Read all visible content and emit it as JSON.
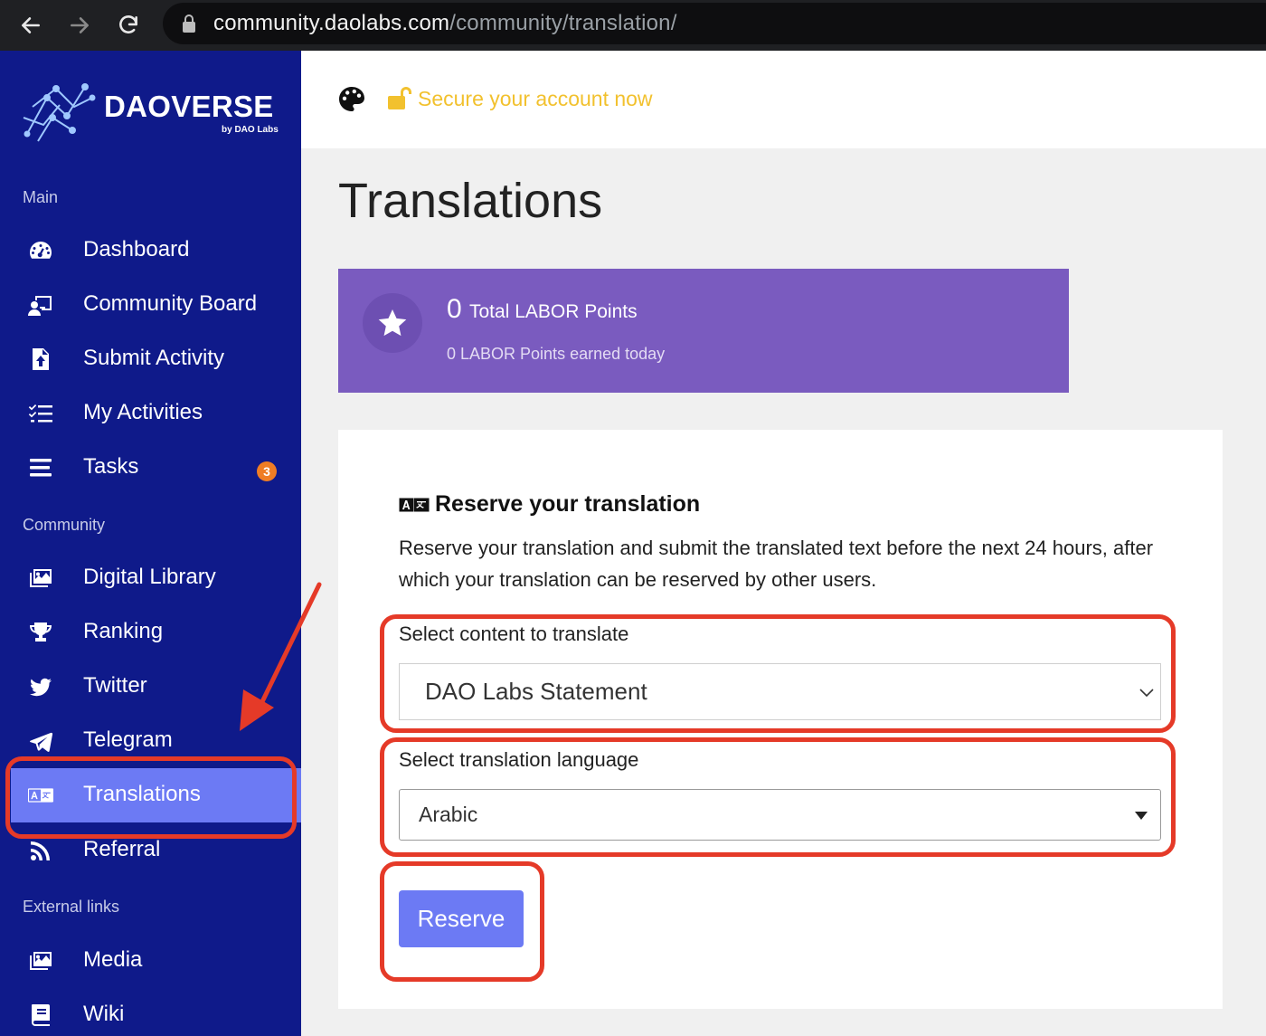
{
  "browser": {
    "url_host": "community.daolabs.com",
    "url_path": "/community/translation/"
  },
  "sidebar": {
    "logo_text": "DAOVERSE",
    "logo_sub": "by DAO Labs",
    "sections": {
      "main": "Main",
      "community": "Community",
      "external": "External links"
    },
    "items": [
      {
        "label": "Dashboard",
        "icon": "gauge-icon"
      },
      {
        "label": "Community Board",
        "icon": "chalkboard-user-icon"
      },
      {
        "label": "Submit Activity",
        "icon": "file-upload-icon"
      },
      {
        "label": "My Activities",
        "icon": "list-check-icon"
      },
      {
        "label": "Tasks",
        "icon": "bars-icon",
        "badge": "3"
      },
      {
        "label": "Digital Library",
        "icon": "images-icon"
      },
      {
        "label": "Ranking",
        "icon": "trophy-icon"
      },
      {
        "label": "Twitter",
        "icon": "twitter-icon"
      },
      {
        "label": "Telegram",
        "icon": "telegram-icon"
      },
      {
        "label": "Translations",
        "icon": "language-icon",
        "active": true
      },
      {
        "label": "Referral",
        "icon": "rss-icon"
      },
      {
        "label": "Media",
        "icon": "images-icon"
      },
      {
        "label": "Wiki",
        "icon": "book-icon"
      }
    ]
  },
  "header": {
    "secure_text": "Secure your account now"
  },
  "page": {
    "title": "Translations"
  },
  "points": {
    "total": "0",
    "total_label": "Total LABOR Points",
    "today_text": "0 LABOR Points earned today"
  },
  "form": {
    "heading": "Reserve your translation",
    "description": "Reserve your translation and submit the translated text before the next 24 hours, after which your translation can be reserved by other users.",
    "content_label": "Select content to translate",
    "content_value": "DAO Labs Statement",
    "language_label": "Select translation language",
    "language_value": "Arabic",
    "reserve_label": "Reserve"
  },
  "colors": {
    "sidebar_bg": "#0f1a8a",
    "active_item": "#6c7af4",
    "points_card": "#7a5bbf",
    "warning_link": "#f2c12e",
    "annotation": "#e53a28",
    "badge": "#ef7d24"
  }
}
